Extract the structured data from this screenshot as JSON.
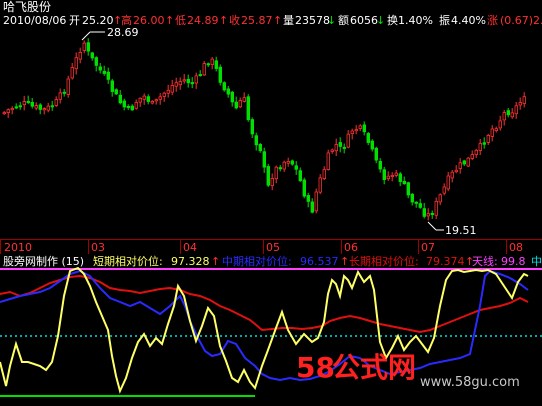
{
  "stock": {
    "name": "哈飞股份"
  },
  "header": {
    "date": "2010/08/06",
    "open_label": "开",
    "open": "25.20",
    "open_arrow": "↑",
    "high_label": "高",
    "high": "26.00",
    "high_arrow": "↑",
    "low_label": "低",
    "low": "24.89",
    "low_arrow": "↑",
    "close_label": "收",
    "close": "25.87",
    "close_arrow": "↑",
    "volume_label": "量",
    "volume": "23578",
    "volume_arrow": "↓",
    "amount_label": "额",
    "amount": "6056",
    "amount_arrow": "↓",
    "turnover_label": "换",
    "turnover": "1.40%",
    "amplitude_label": "振",
    "amplitude": "4.40%",
    "change_label": "涨",
    "change": "(0.67)",
    "change_pct_clipped": "2."
  },
  "annotations": {
    "high_marker": "28.69",
    "low_marker": "19.51"
  },
  "time_axis": [
    "2010",
    "03",
    "04",
    "05",
    "06",
    "07",
    "08"
  ],
  "indicator": {
    "name": "股旁网制作 (15)",
    "short_label": "短期相对价位:",
    "short_value": "97.328",
    "short_arrow": "↑",
    "mid_label": "中期相对价位:",
    "mid_value": "96.537",
    "mid_arrow": "↑",
    "long_label": "长期相对价位:",
    "long_value": "79.374",
    "long_arrow": "↑",
    "sky_label": "天线:",
    "sky_value": "99.8",
    "clipped": "中"
  },
  "watermark": {
    "logo_num": "58",
    "logo_text": "公式网",
    "url": "www.58gu.com"
  },
  "colors": {
    "up": "#ff3030",
    "down": "#00e000",
    "short_line": "#ffff66",
    "mid_line": "#2a2aff",
    "long_line": "#e01010",
    "sky_line": "#ff40ff",
    "ground_line": "#00e000",
    "mid_ref_line": "#00e0e0"
  }
}
